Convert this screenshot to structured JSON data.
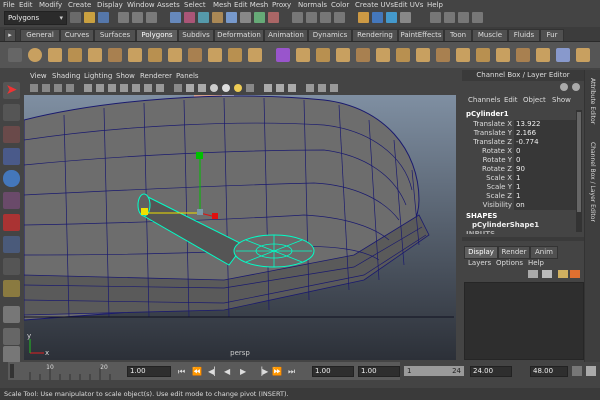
{
  "menu": [
    "File",
    "Edit",
    "Modify",
    "Create",
    "Display",
    "Window",
    "Assets",
    "Select",
    "Mesh",
    "Edit Mesh",
    "Proxy",
    "Normals",
    "Color",
    "Create UVs",
    "Edit UVs",
    "Help"
  ],
  "mode_dropdown": "Polygons",
  "shelf_tabs": [
    "General",
    "Curves",
    "Surfaces",
    "Polygons",
    "Subdivs",
    "Deformation",
    "Animation",
    "Dynamics",
    "Rendering",
    "PaintEffects",
    "Toon",
    "Muscle",
    "Fluids",
    "Fur"
  ],
  "shelf_active": "Polygons",
  "viewport_menu": [
    "View",
    "Shading",
    "Lighting",
    "Show",
    "Renderer",
    "Panels"
  ],
  "viewport_label": "persp",
  "axis": {
    "x": "x",
    "y": "y"
  },
  "channel_box": {
    "title": "Channel Box / Layer Editor",
    "menu": [
      "Channels",
      "Edit",
      "Object",
      "Show"
    ],
    "object_name": "pCylinder1",
    "attributes": [
      {
        "label": "Translate X",
        "value": "13.922"
      },
      {
        "label": "Translate Y",
        "value": "2.166"
      },
      {
        "label": "Translate Z",
        "value": "-0.774"
      },
      {
        "label": "Rotate X",
        "value": "0"
      },
      {
        "label": "Rotate Y",
        "value": "0"
      },
      {
        "label": "Rotate Z",
        "value": "90"
      },
      {
        "label": "Scale X",
        "value": "1"
      },
      {
        "label": "Scale Y",
        "value": "1"
      },
      {
        "label": "Scale Z",
        "value": "1"
      },
      {
        "label": "Visibility",
        "value": "on"
      }
    ],
    "shapes_header": "SHAPES",
    "shape_name": "pCylinderShape1",
    "inputs_header": "INPUTS"
  },
  "layer_tabs": [
    "Display",
    "Render",
    "Anim"
  ],
  "layer_active": "Display",
  "layer_menu": [
    "Layers",
    "Options",
    "Help"
  ],
  "side_tabs": [
    "Attribute Editor",
    "Channel Box / Layer Editor"
  ],
  "timeline": {
    "ticks": [
      "10",
      "20"
    ],
    "current_frame": "1.00"
  },
  "range": {
    "start": "1.00",
    "inner_start": "1.00",
    "inner_current": "1",
    "inner_end": "24",
    "end": "24.00",
    "max": "48.00"
  },
  "status": "Scale Tool: Use manipulator to scale object(s). Use edit mode to change pivot (INSERT).",
  "colors": {
    "accent": "#00ffc8",
    "wire": "#1a1a6e",
    "handle_green": "#00c000",
    "handle_yellow": "#f0e000",
    "handle_red": "#e01010"
  }
}
